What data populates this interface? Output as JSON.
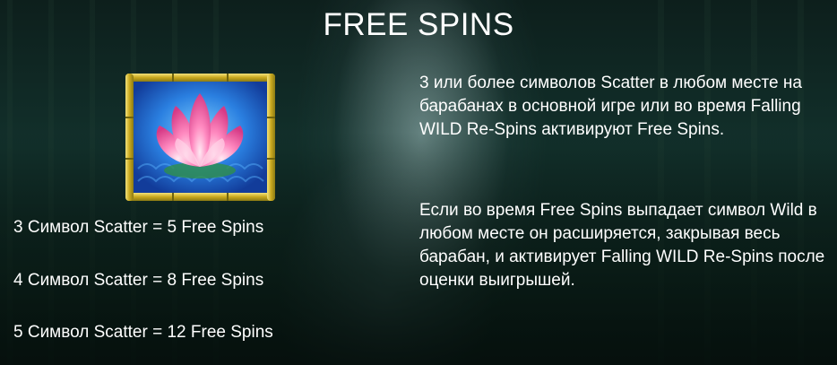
{
  "title": "FREE SPINS",
  "symbol_icon": "lotus-scatter-icon",
  "paytable": [
    "3 Символ Scatter = 5 Free Spins",
    "4 Символ Scatter = 8 Free Spins",
    "5 Символ Scatter = 12 Free Spins"
  ],
  "description": [
    "3 или более символов Scatter в любом месте на барабанах в основной игре или во время Falling WILD Re-Spins активируют Free Spins.",
    "Если во время Free Spins выпадает символ Wild в любом месте он расширяется, закрывая весь барабан, и активирует Falling WILD Re-Spins после оценки выигрышей."
  ],
  "colors": {
    "text": "#ffffff",
    "frame": "#d8c33a",
    "lotus": "#f06aa8",
    "tile_bg": "#1c5fc4"
  }
}
